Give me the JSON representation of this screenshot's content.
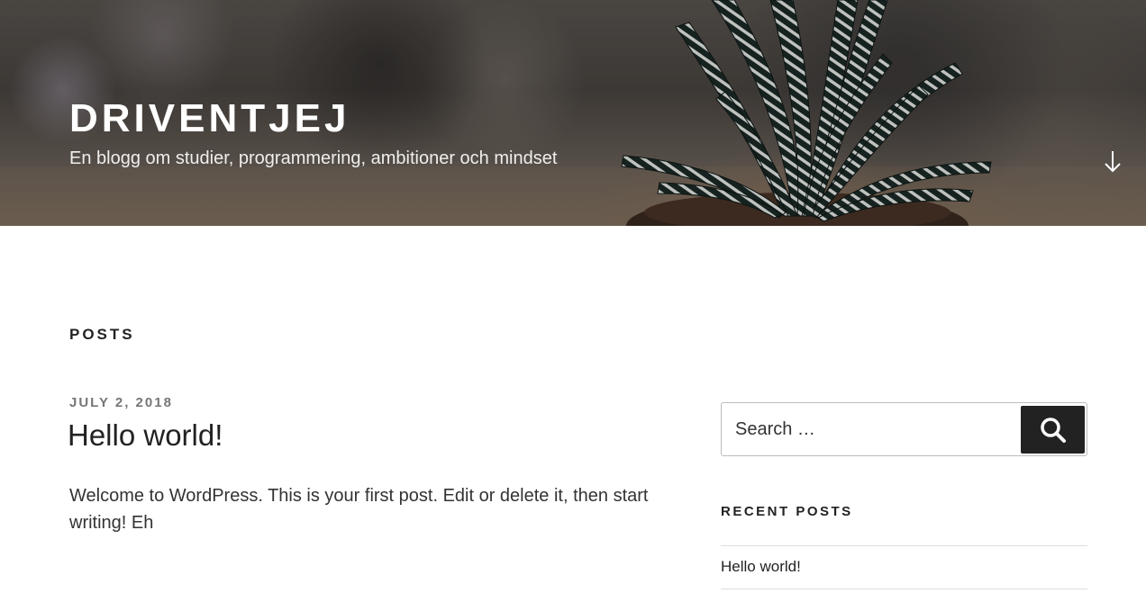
{
  "header": {
    "site_title": "DRIVENTJEJ",
    "site_description": "En blogg om studier, programmering, ambitioner och mindset",
    "scroll_icon": "arrow-down-icon"
  },
  "main": {
    "page_title": "POSTS",
    "posts": [
      {
        "date": "JULY 2, 2018",
        "title": "Hello world!",
        "excerpt": "Welcome to WordPress. This is your first post. Edit or delete it, then start writing! Eh"
      }
    ]
  },
  "sidebar": {
    "search": {
      "placeholder": "Search …",
      "button_icon": "search-icon"
    },
    "recent_posts": {
      "title": "RECENT POSTS",
      "items": [
        "Hello world!"
      ]
    }
  },
  "colors": {
    "text_dark": "#222222",
    "text_body": "#333333",
    "text_meta": "#767676",
    "search_button_bg": "#222222",
    "divider": "#dddddd"
  }
}
